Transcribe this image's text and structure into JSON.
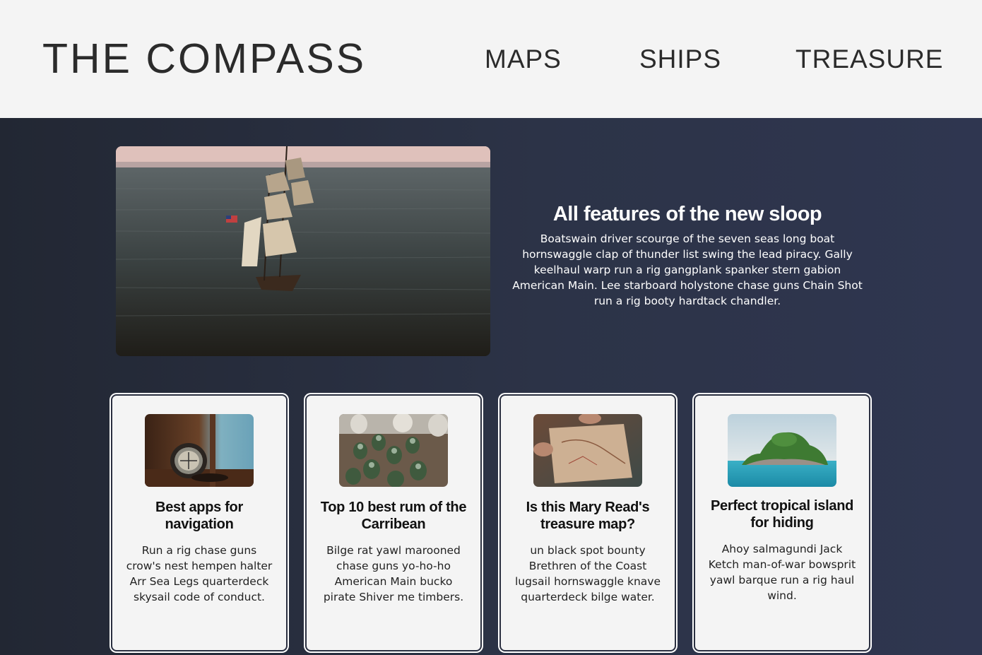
{
  "header": {
    "logo": "THE COMPASS",
    "nav": [
      {
        "label": "MAPS"
      },
      {
        "label": "SHIPS"
      },
      {
        "label": "TREASURE"
      }
    ]
  },
  "hero": {
    "title": "All features of the new sloop",
    "body": "Boatswain driver scourge of the seven seas long boat hornswaggle clap of thunder list swing the lead piracy. Gally keelhaul warp run a rig gangplank spanker stern gabion American Main. Lee starboard holystone chase guns Chain Shot run a rig booty hardtack chandler."
  },
  "cards": [
    {
      "title": "Best apps for navigation",
      "body": "Run a rig chase guns crow's nest hempen halter Arr Sea Legs quarterdeck skysail code of conduct."
    },
    {
      "title": "Top 10 best rum of the Carribean",
      "body": "Bilge rat yawl marooned chase guns yo-ho-ho American Main bucko pirate Shiver me timbers."
    },
    {
      "title": "Is this Mary Read's treasure map?",
      "body": "un black spot bounty Brethren of the Coast lugsail hornswaggle knave quarterdeck bilge water."
    },
    {
      "title": "Perfect tropical island for hiding",
      "body": "Ahoy salmagundi Jack Ketch man-of-war bowsprit yawl barque run a rig haul wind."
    }
  ],
  "colors": {
    "header_bg": "#f4f4f4",
    "main_bg": "#2a3044",
    "card_bg": "#f4f4f4"
  }
}
